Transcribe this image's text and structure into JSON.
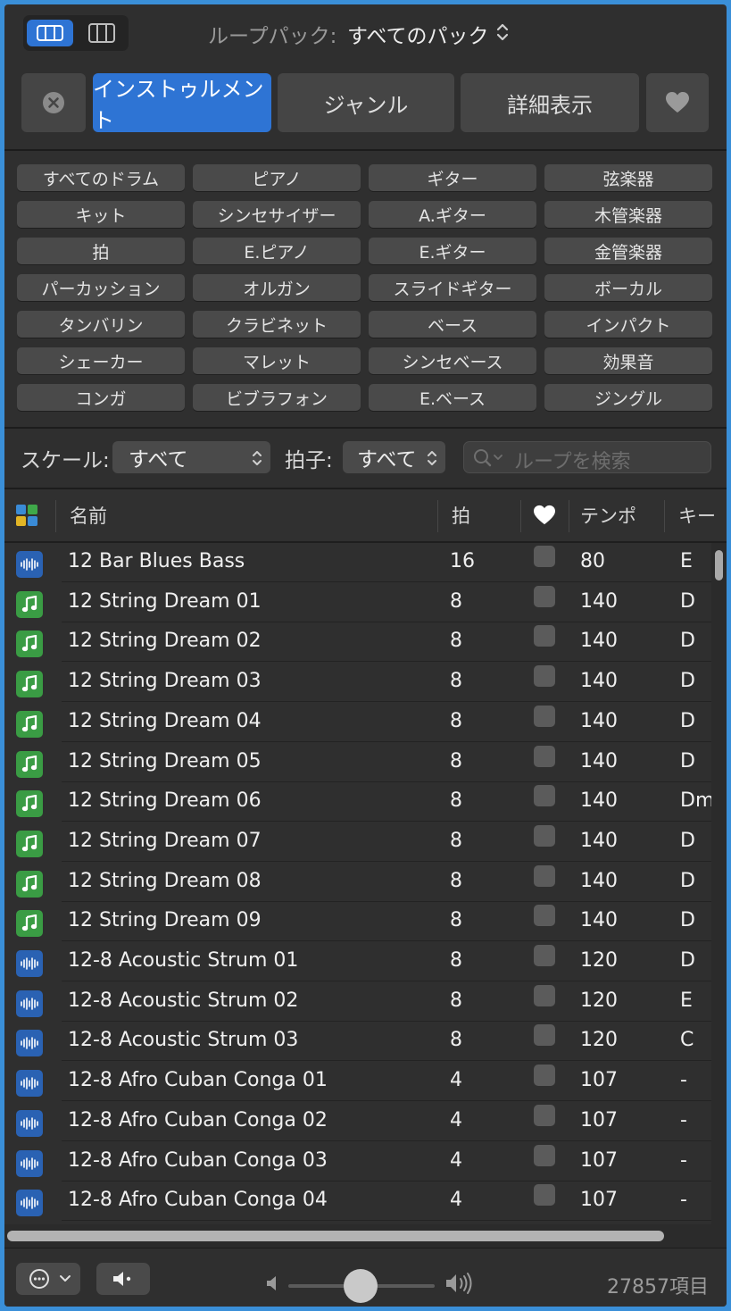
{
  "top": {
    "pack_label": "ループパック:",
    "pack_value": "すべてのパック"
  },
  "tabs": {
    "instruments": "インストゥルメント",
    "genre": "ジャンル",
    "details": "詳細表示"
  },
  "keywords": [
    [
      "すべてのドラム",
      "ピアノ",
      "ギター",
      "弦楽器"
    ],
    [
      "キット",
      "シンセサイザー",
      "A.ギター",
      "木管楽器"
    ],
    [
      "拍",
      "E.ピアノ",
      "E.ギター",
      "金管楽器"
    ],
    [
      "パーカッション",
      "オルガン",
      "スライドギター",
      "ボーカル"
    ],
    [
      "タンバリン",
      "クラビネット",
      "ベース",
      "インパクト"
    ],
    [
      "シェーカー",
      "マレット",
      "シンセベース",
      "効果音"
    ],
    [
      "コンガ",
      "ビブラフォン",
      "E.ベース",
      "ジングル"
    ]
  ],
  "filters": {
    "scale_label": "スケール:",
    "scale_value": "すべて",
    "signature_label": "拍子:",
    "signature_value": "すべて",
    "search_placeholder": "ループを検索"
  },
  "columns": {
    "name": "名前",
    "beats": "拍",
    "tempo": "テンポ",
    "key": "キー"
  },
  "rows": [
    {
      "type": "audio",
      "name": "12 Bar Blues Bass",
      "beats": "16",
      "tempo": "80",
      "key": "E"
    },
    {
      "type": "midi",
      "name": "12 String Dream 01",
      "beats": "8",
      "tempo": "140",
      "key": "D"
    },
    {
      "type": "midi",
      "name": "12 String Dream 02",
      "beats": "8",
      "tempo": "140",
      "key": "D"
    },
    {
      "type": "midi",
      "name": "12 String Dream 03",
      "beats": "8",
      "tempo": "140",
      "key": "D"
    },
    {
      "type": "midi",
      "name": "12 String Dream 04",
      "beats": "8",
      "tempo": "140",
      "key": "D"
    },
    {
      "type": "midi",
      "name": "12 String Dream 05",
      "beats": "8",
      "tempo": "140",
      "key": "D"
    },
    {
      "type": "midi",
      "name": "12 String Dream 06",
      "beats": "8",
      "tempo": "140",
      "key": "Dm"
    },
    {
      "type": "midi",
      "name": "12 String Dream 07",
      "beats": "8",
      "tempo": "140",
      "key": "D"
    },
    {
      "type": "midi",
      "name": "12 String Dream 08",
      "beats": "8",
      "tempo": "140",
      "key": "D"
    },
    {
      "type": "midi",
      "name": "12 String Dream 09",
      "beats": "8",
      "tempo": "140",
      "key": "D"
    },
    {
      "type": "audio",
      "name": "12-8 Acoustic Strum 01",
      "beats": "8",
      "tempo": "120",
      "key": "D"
    },
    {
      "type": "audio",
      "name": "12-8 Acoustic Strum 02",
      "beats": "8",
      "tempo": "120",
      "key": "E"
    },
    {
      "type": "audio",
      "name": "12-8 Acoustic Strum 03",
      "beats": "8",
      "tempo": "120",
      "key": "C"
    },
    {
      "type": "audio",
      "name": "12-8 Afro Cuban Conga 01",
      "beats": "4",
      "tempo": "107",
      "key": "-"
    },
    {
      "type": "audio",
      "name": "12-8 Afro Cuban Conga 02",
      "beats": "4",
      "tempo": "107",
      "key": "-"
    },
    {
      "type": "audio",
      "name": "12-8 Afro Cuban Conga 03",
      "beats": "4",
      "tempo": "107",
      "key": "-"
    },
    {
      "type": "audio",
      "name": "12-8 Afro Cuban Conga 04",
      "beats": "4",
      "tempo": "107",
      "key": "-"
    }
  ],
  "status": {
    "count": "27857項目"
  },
  "colors": {
    "accent": "#2e74d4",
    "audio_icon": "#2a62b3",
    "midi_icon": "#3a9c44",
    "background": "#2f2f2f"
  }
}
